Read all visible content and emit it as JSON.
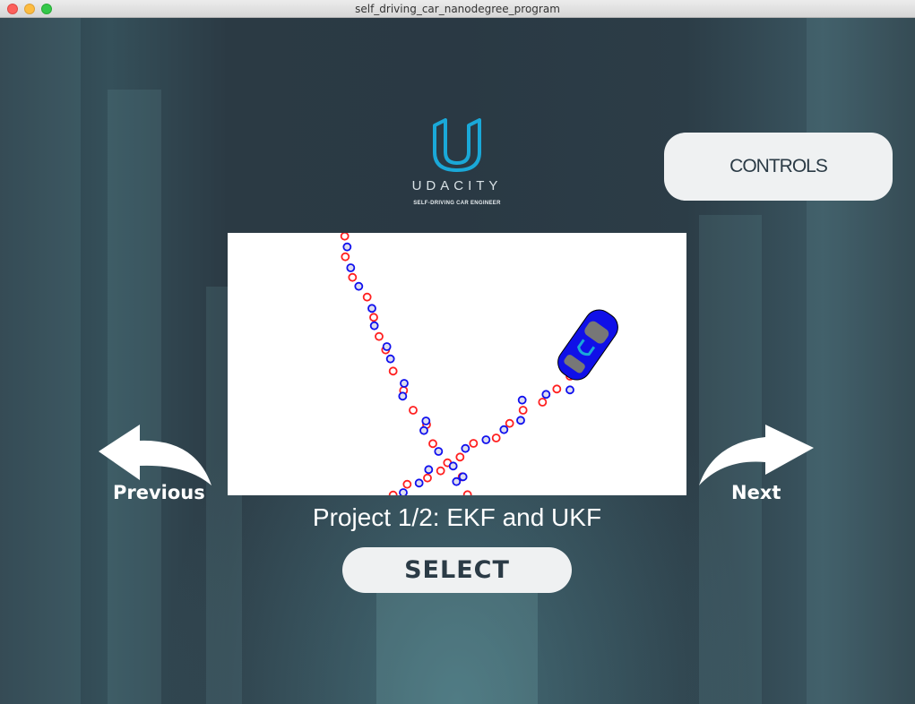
{
  "window": {
    "title": "self_driving_car_nanodegree_program"
  },
  "logo": {
    "name": "UDACITY",
    "subtitle": "SELF-DRIVING CAR ENGINEER"
  },
  "controls": {
    "label": "CONTROLS"
  },
  "navigation": {
    "previous_label": "Previous",
    "next_label": "Next"
  },
  "project": {
    "caption": "Project 1/2: EKF and UKF",
    "select_label": "SELECT"
  },
  "colors": {
    "accent": "#1aa8d8",
    "background": "#2b3a44",
    "button": "#eff1f2",
    "button_text": "#2b3b46",
    "lidar": "#ff2020",
    "radar": "#1010ee",
    "car": "#1010e8"
  }
}
